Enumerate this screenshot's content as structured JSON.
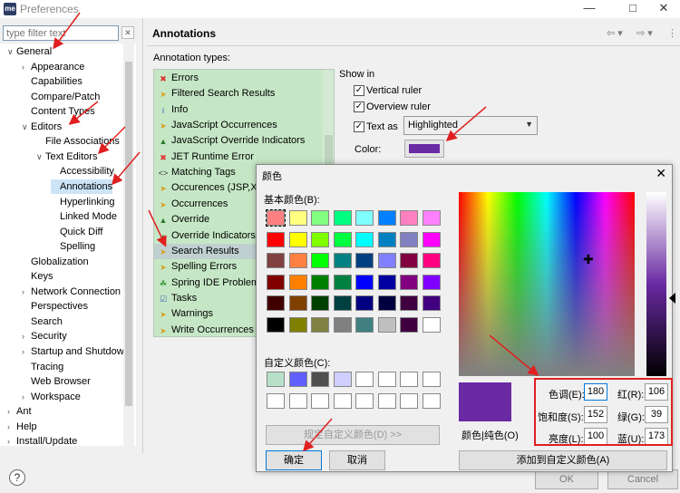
{
  "window": {
    "title": "Preferences",
    "app_icon": "me"
  },
  "filter": {
    "placeholder": "type filter text"
  },
  "tree": [
    {
      "label": "General",
      "depth": 0,
      "expanded": true
    },
    {
      "label": "Appearance",
      "depth": 1,
      "expanded": false
    },
    {
      "label": "Capabilities",
      "depth": 1
    },
    {
      "label": "Compare/Patch",
      "depth": 1
    },
    {
      "label": "Content Types",
      "depth": 1
    },
    {
      "label": "Editors",
      "depth": 1,
      "expanded": true
    },
    {
      "label": "File Associations",
      "depth": 2
    },
    {
      "label": "Text Editors",
      "depth": 2,
      "expanded": true
    },
    {
      "label": "Accessibility",
      "depth": 3
    },
    {
      "label": "Annotations",
      "depth": 3,
      "selected": true
    },
    {
      "label": "Hyperlinking",
      "depth": 3
    },
    {
      "label": "Linked Mode",
      "depth": 3
    },
    {
      "label": "Quick Diff",
      "depth": 3
    },
    {
      "label": "Spelling",
      "depth": 3
    },
    {
      "label": "Globalization",
      "depth": 1
    },
    {
      "label": "Keys",
      "depth": 1
    },
    {
      "label": "Network Connection",
      "depth": 1,
      "expanded": false
    },
    {
      "label": "Perspectives",
      "depth": 1
    },
    {
      "label": "Search",
      "depth": 1
    },
    {
      "label": "Security",
      "depth": 1,
      "expanded": false
    },
    {
      "label": "Startup and Shutdown",
      "depth": 1,
      "expanded": false
    },
    {
      "label": "Tracing",
      "depth": 1
    },
    {
      "label": "Web Browser",
      "depth": 1
    },
    {
      "label": "Workspace",
      "depth": 1,
      "expanded": false
    },
    {
      "label": "Ant",
      "depth": 0,
      "expanded": false
    },
    {
      "label": "Help",
      "depth": 0,
      "expanded": false
    },
    {
      "label": "Install/Update",
      "depth": 0,
      "expanded": false
    }
  ],
  "page": {
    "title": "Annotations",
    "annotation_types_label": "Annotation types:"
  },
  "annotations": [
    {
      "label": "Errors",
      "icon": "error-icon"
    },
    {
      "label": "Filtered Search Results",
      "icon": "arrow-icon"
    },
    {
      "label": "Info",
      "icon": "info-icon"
    },
    {
      "label": "JavaScript Occurrences",
      "icon": "arrow-icon"
    },
    {
      "label": "JavaScript Override Indicators",
      "icon": "triangle-icon"
    },
    {
      "label": "JET Runtime Error",
      "icon": "error-icon"
    },
    {
      "label": "Matching Tags",
      "icon": "tag-icon"
    },
    {
      "label": "Occurences (JSP,XML)",
      "icon": "arrow-icon"
    },
    {
      "label": "Occurrences",
      "icon": "arrow-icon"
    },
    {
      "label": "Override",
      "icon": "triangle-icon"
    },
    {
      "label": "Override Indicators",
      "icon": "triangle-icon"
    },
    {
      "label": "Search Results",
      "icon": "arrow-icon",
      "selected": true
    },
    {
      "label": "Spelling Errors",
      "icon": "arrow-icon"
    },
    {
      "label": "Spring IDE Problem",
      "icon": "leaf-icon"
    },
    {
      "label": "Tasks",
      "icon": "task-icon"
    },
    {
      "label": "Warnings",
      "icon": "arrow-icon"
    },
    {
      "label": "Write Occurrences",
      "icon": "arrow-icon"
    }
  ],
  "show_in": {
    "label": "Show in",
    "vertical_ruler": "Vertical ruler",
    "overview_ruler": "Overview ruler",
    "text_as": "Text as",
    "text_as_value": "Highlighted",
    "color_label": "Color:",
    "color_value": "#6a2aa3"
  },
  "footer": {
    "ok": "OK",
    "cancel": "Cancel",
    "help": "?"
  },
  "color_dialog": {
    "title": "颜色",
    "basic_colors_label": "基本颜色(B):",
    "custom_colors_label": "自定义颜色(C):",
    "define_custom": "规定自定义颜色(D) >>",
    "ok": "确定",
    "cancel": "取消",
    "add_custom": "添加到自定义颜色(A)",
    "solid_label": "颜色|纯色(O)",
    "hue_label": "色调(E):",
    "hue": "180",
    "sat_label": "饱和度(S):",
    "sat": "152",
    "lum_label": "亮度(L):",
    "lum": "100",
    "red_label": "红(R):",
    "red": "106",
    "green_label": "绿(G):",
    "green": "39",
    "blue_label": "蓝(U):",
    "blue": "173",
    "basic_colors": [
      "#ff8080",
      "#ffff80",
      "#80ff80",
      "#00ff80",
      "#80ffff",
      "#0080ff",
      "#ff80c0",
      "#ff80ff",
      "#ff0000",
      "#ffff00",
      "#80ff00",
      "#00ff40",
      "#00ffff",
      "#0080c0",
      "#8080c0",
      "#ff00ff",
      "#804040",
      "#ff8040",
      "#00ff00",
      "#008080",
      "#004080",
      "#8080ff",
      "#800040",
      "#ff0080",
      "#800000",
      "#ff8000",
      "#008000",
      "#008040",
      "#0000ff",
      "#0000a0",
      "#800080",
      "#8000ff",
      "#400000",
      "#804000",
      "#004000",
      "#004040",
      "#000080",
      "#000040",
      "#400040",
      "#400080",
      "#000000",
      "#808000",
      "#808040",
      "#808080",
      "#408080",
      "#c0c0c0",
      "#400040",
      "#ffffff"
    ],
    "custom_colors": [
      "#b8e0c8",
      "#6060ff",
      "#505050",
      "#d0d0ff",
      "#ffffff",
      "#ffffff",
      "#ffffff",
      "#ffffff",
      "#ffffff",
      "#ffffff",
      "#ffffff",
      "#ffffff",
      "#ffffff",
      "#ffffff",
      "#ffffff",
      "#ffffff"
    ]
  }
}
